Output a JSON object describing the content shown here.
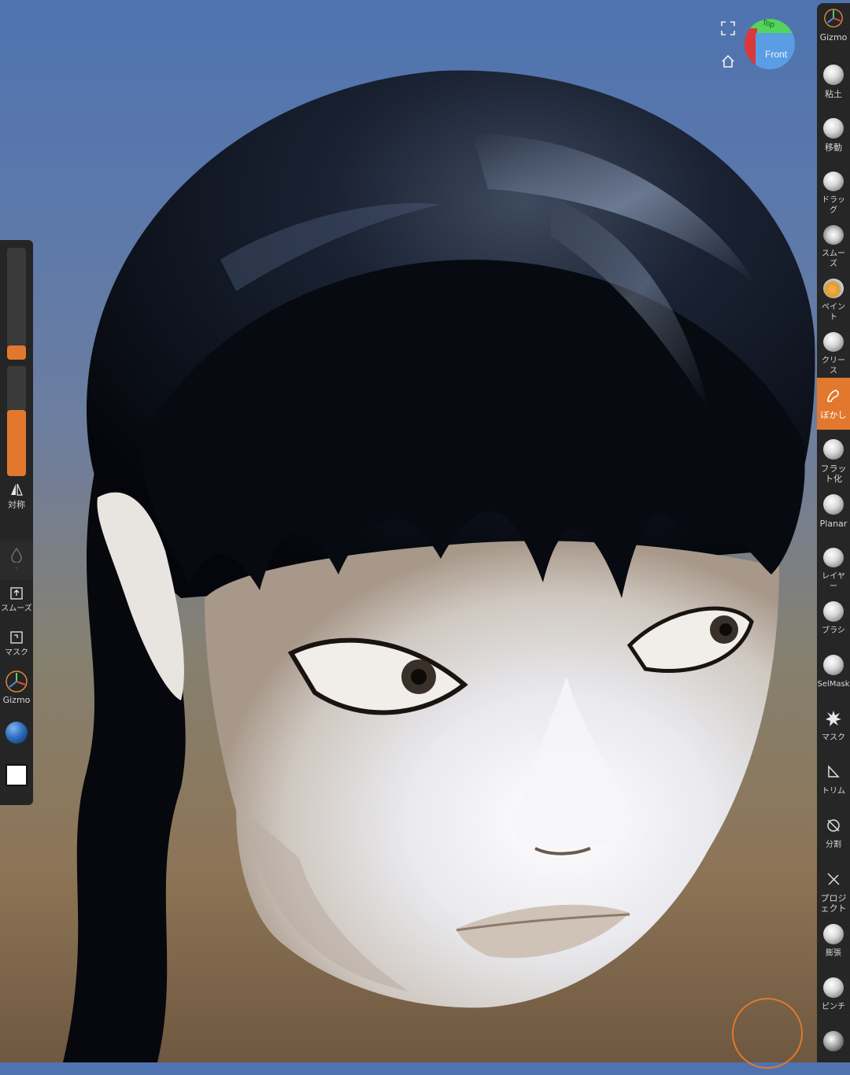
{
  "viewport": {
    "model": "sculpted head with long black braided hair"
  },
  "view_controls": {
    "fullscreen_icon": "fullscreen-corners-icon",
    "home_icon": "home-icon",
    "nav_cube": {
      "top_label": "Top",
      "front_label": "Front"
    }
  },
  "right_tools": [
    {
      "id": "gizmo",
      "label": "Gizmo",
      "icon": "gizmo-axes-icon"
    },
    {
      "id": "clay",
      "label": "粘土",
      "icon": "clay-brush-icon"
    },
    {
      "id": "move",
      "label": "移動",
      "icon": "move-brush-icon"
    },
    {
      "id": "drag",
      "label": "ドラッグ",
      "icon": "drag-brush-icon"
    },
    {
      "id": "smooth",
      "label": "スムーズ",
      "icon": "smooth-brush-icon"
    },
    {
      "id": "paint",
      "label": "ペイント",
      "icon": "paint-brush-icon"
    },
    {
      "id": "crease",
      "label": "クリース",
      "icon": "crease-brush-icon"
    },
    {
      "id": "blur",
      "label": "ぼかし",
      "icon": "blur-brush-icon",
      "active": true
    },
    {
      "id": "flatten",
      "label": "フラット化",
      "icon": "flatten-brush-icon"
    },
    {
      "id": "planar",
      "label": "Planar",
      "icon": "planar-brush-icon"
    },
    {
      "id": "layer",
      "label": "レイヤー",
      "icon": "layer-brush-icon"
    },
    {
      "id": "brush",
      "label": "ブラシ",
      "icon": "standard-brush-icon"
    },
    {
      "id": "selmask",
      "label": "SelMask",
      "icon": "selmask-brush-icon"
    },
    {
      "id": "mask",
      "label": "マスク",
      "icon": "mask-splat-icon"
    },
    {
      "id": "trim",
      "label": "トリム",
      "icon": "trim-icon"
    },
    {
      "id": "split",
      "label": "分割",
      "icon": "split-icon"
    },
    {
      "id": "project",
      "label": "プロジェクト",
      "icon": "project-icon"
    },
    {
      "id": "inflate",
      "label": "膨張",
      "icon": "inflate-brush-icon"
    },
    {
      "id": "pinch",
      "label": "ピンチ",
      "icon": "pinch-brush-icon"
    },
    {
      "id": "more",
      "label": "",
      "icon": "brush-ball-icon"
    }
  ],
  "left_panel": {
    "radius_slider": {
      "value": 0.08,
      "color": "#e1782d"
    },
    "intensity_slider": {
      "value": 0.6,
      "color": "#e1782d"
    },
    "symmetry": {
      "label": "対称",
      "icon": "symmetry-icon"
    },
    "pressure": {
      "label": "-",
      "icon": "pressure-drop-icon"
    },
    "smooth": {
      "label": "スムーズ",
      "icon": "smooth-toggle-icon"
    },
    "mask": {
      "label": "マスク",
      "icon": "mask-toggle-icon"
    },
    "gizmo": {
      "label": "Gizmo",
      "icon": "gizmo-axes-icon"
    },
    "material": {
      "icon": "material-ball-icon"
    },
    "color": {
      "value": "#ffffff"
    }
  },
  "cursor": {
    "color": "#e1782d"
  }
}
